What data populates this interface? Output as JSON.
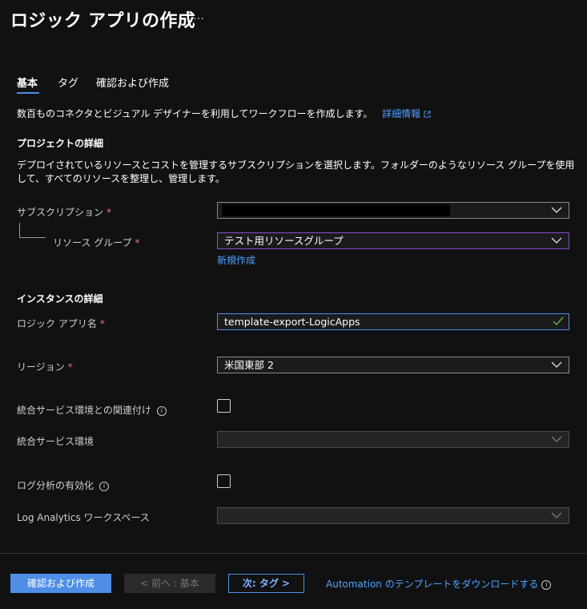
{
  "header": {
    "title": "ロジック アプリの作成",
    "more": "…"
  },
  "tabs": [
    {
      "label": "基本"
    },
    {
      "label": "タグ"
    },
    {
      "label": "確認および作成"
    }
  ],
  "intro": {
    "text": "数百ものコネクタとビジュアル デザイナーを利用してワークフローを作成します。",
    "link": "詳細情報"
  },
  "project": {
    "heading": "プロジェクトの詳細",
    "description": "デプロイされているリソースとコストを管理するサブスクリプションを選択します。フォルダーのようなリソース グループを使用して、すべてのリソースを整理し、管理します。",
    "subscription_label": "サブスクリプション",
    "subscription_value": "",
    "resource_group_label": "リソース グループ",
    "resource_group_value": "テスト用リソースグループ",
    "new_link": "新規作成"
  },
  "instance": {
    "heading": "インスタンスの詳細",
    "name_label": "ロジック アプリ名",
    "name_value": "template-export-LogicApps",
    "region_label": "リージョン",
    "region_value": "米国東部 2",
    "ise_assoc_label": "統合サービス環境との関連付け",
    "ise_label": "統合サービス環境",
    "log_label": "ログ分析の有効化",
    "workspace_label": "Log Analytics ワークスペース"
  },
  "required_mark": "*",
  "info_glyph": "i",
  "footer": {
    "review_button": "確認および作成",
    "prev_button": "< 前へ : 基本",
    "next_button": "次: タグ >",
    "download_link": "Automation のテンプレートをダウンロードする"
  },
  "colors": {
    "background": "#111112",
    "accent": "#4f8ee6",
    "link": "#4da3ff",
    "required": "#f1707b",
    "focus_purple": "#8a4cc8",
    "valid_check": "#5fb944"
  }
}
